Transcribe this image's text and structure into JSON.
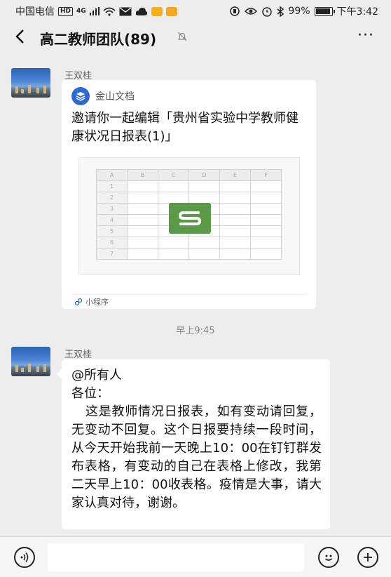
{
  "status_bar": {
    "carrier": "中国电信",
    "hd": "HD",
    "network": "4G",
    "battery": "99%",
    "time": "下午3:42"
  },
  "header": {
    "title": "高二教师团队(89)",
    "back_icon": "chevron-left-icon",
    "mute_icon": "bell-off-icon",
    "more_icon": "ellipsis-icon",
    "more_label": "···"
  },
  "messages": [
    {
      "sender": "王双桂",
      "card": {
        "app_name": "金山文档",
        "description": "邀请你一起编辑「贵州省实验中学教师健康状况日报表(1)」",
        "columns": [
          "A",
          "B",
          "C",
          "D",
          "E",
          "F"
        ],
        "rows": [
          "1",
          "2",
          "3",
          "4",
          "5",
          "6",
          "7"
        ],
        "mini_program_label": "小程序"
      }
    },
    {
      "sender": "王双桂",
      "lines": {
        "mention": "@所有人",
        "greeting": "各位：",
        "body": "这是教师情况日报表，如有变动请回复，无变动不回复。这个日报要持续一段时间，从今天开始我前一天晚上10：00在钉钉群发布表格，有变动的自己在表格上修改，我第二天早上10：00收表格。疫情是大事，请大家认真对待，谢谢。"
      }
    }
  ],
  "timestamp": "早上9:45",
  "input_bar": {
    "voice_icon": "voice-icon",
    "emoji_icon": "emoji-icon",
    "plus_icon": "plus-icon"
  },
  "colors": {
    "background": "#ededed",
    "bubble": "#ffffff",
    "kdocs_blue": "#2e6ad6",
    "sheet_green": "#5a9a47"
  }
}
